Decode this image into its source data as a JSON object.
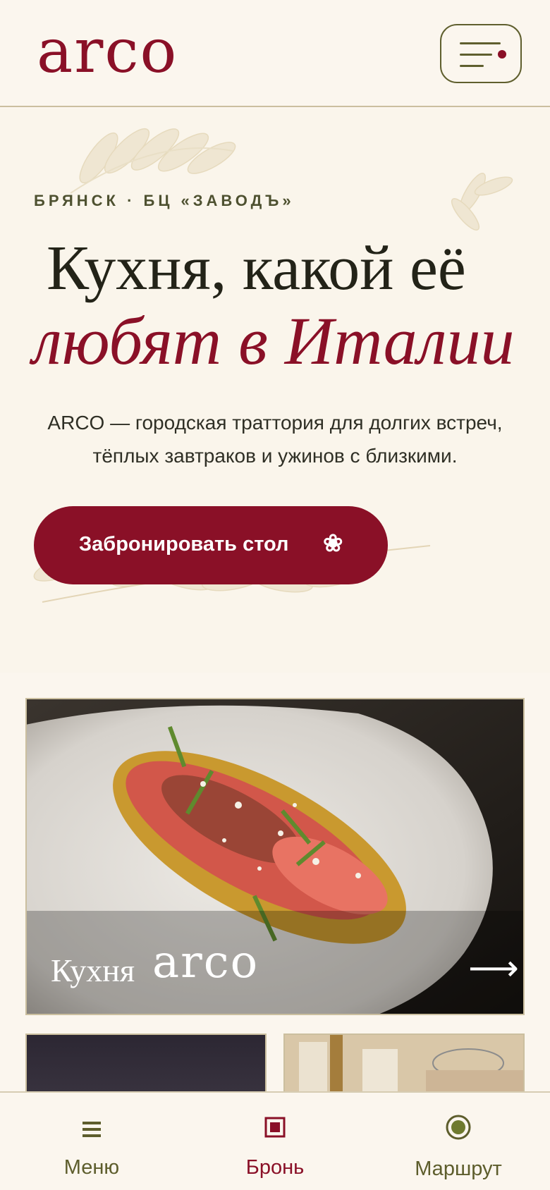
{
  "header": {
    "logo": "arco",
    "menu_button": "menu-icon"
  },
  "hero": {
    "eyebrow": "БРЯНСК · БЦ «ЗАВОДЪ»",
    "title_line1": "Кухня, какой её",
    "title_line2": "любят в Италии",
    "lead_line1": "ARCO — городская траттория для долгих встреч,",
    "lead_line2": "тёплых завтраков и ужинов с близкими.",
    "cta_label": "Забронировать стол",
    "cta_icon": "❀"
  },
  "cards": {
    "main_title": "Кухня",
    "main_logo": "arco",
    "main_arrow": "⟶"
  },
  "bottom_nav": {
    "items": [
      {
        "label": "Меню",
        "icon": "menu-lines-icon"
      },
      {
        "label": "Бронь",
        "icon": "booking-square-icon"
      },
      {
        "label": "Маршрут",
        "icon": "location-target-icon"
      }
    ]
  },
  "colors": {
    "accent": "#8a1027",
    "olive": "#5d5d2c",
    "background": "#fbf6ee"
  }
}
